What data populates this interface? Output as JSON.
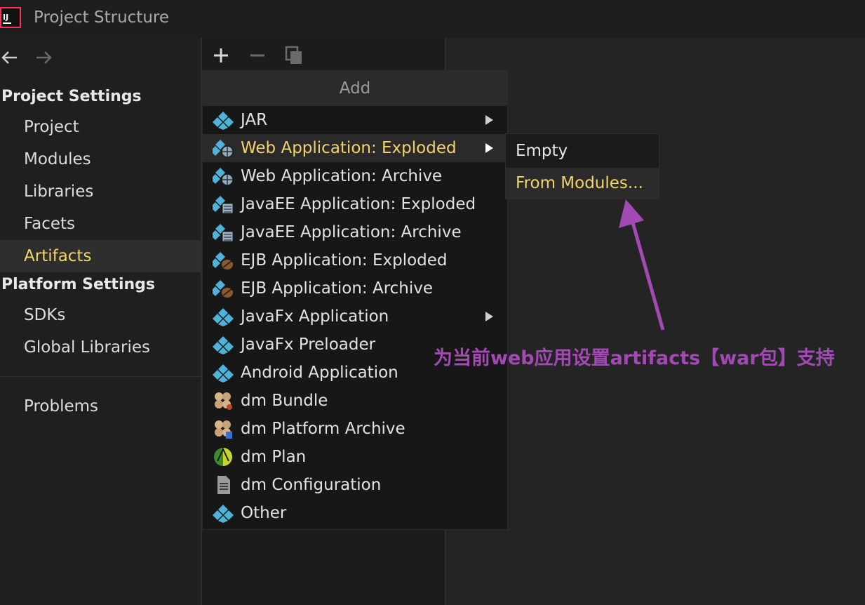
{
  "window": {
    "title": "Project Structure",
    "logo_text": "IJ"
  },
  "sidebar": {
    "project_settings_header": "Project Settings",
    "project_items": [
      "Project",
      "Modules",
      "Libraries",
      "Facets",
      "Artifacts"
    ],
    "selected": "Artifacts",
    "platform_settings_header": "Platform Settings",
    "platform_items": [
      "SDKs",
      "Global Libraries"
    ],
    "problems": "Problems"
  },
  "popup": {
    "header": "Add",
    "items": [
      {
        "label": "JAR",
        "icon": "artifact-diamond-icon",
        "submenu": true
      },
      {
        "label": "Web Application: Exploded",
        "icon": "web-globe-icon",
        "submenu": true
      },
      {
        "label": "Web Application: Archive",
        "icon": "web-globe-icon",
        "submenu": false
      },
      {
        "label": "JavaEE Application: Exploded",
        "icon": "javaee-icon",
        "submenu": false
      },
      {
        "label": "JavaEE Application: Archive",
        "icon": "javaee-icon",
        "submenu": false
      },
      {
        "label": "EJB Application: Exploded",
        "icon": "ejb-bean-icon",
        "submenu": false
      },
      {
        "label": "EJB Application: Archive",
        "icon": "ejb-bean-icon",
        "submenu": false
      },
      {
        "label": "JavaFx Application",
        "icon": "artifact-diamond-icon",
        "submenu": true
      },
      {
        "label": "JavaFx Preloader",
        "icon": "artifact-diamond-icon",
        "submenu": false
      },
      {
        "label": "Android Application",
        "icon": "artifact-diamond-icon",
        "submenu": false
      },
      {
        "label": "dm Bundle",
        "icon": "dm-bundle-icon",
        "submenu": false
      },
      {
        "label": "dm Platform Archive",
        "icon": "dm-platform-icon",
        "submenu": false
      },
      {
        "label": "dm Plan",
        "icon": "dm-plan-icon",
        "submenu": false
      },
      {
        "label": "dm Configuration",
        "icon": "dm-config-file-icon",
        "submenu": false
      },
      {
        "label": "Other",
        "icon": "artifact-diamond-icon",
        "submenu": false
      }
    ],
    "active": "Web Application: Exploded"
  },
  "submenu": {
    "items": [
      "Empty",
      "From Modules..."
    ],
    "active": "From Modules..."
  },
  "annotation": {
    "text": "为当前web应用设置artifacts【war包】支持",
    "color": "#a24ab3"
  },
  "colors": {
    "highlight_text": "#f3d36b",
    "accent_diamond": "#4fb3d9"
  }
}
